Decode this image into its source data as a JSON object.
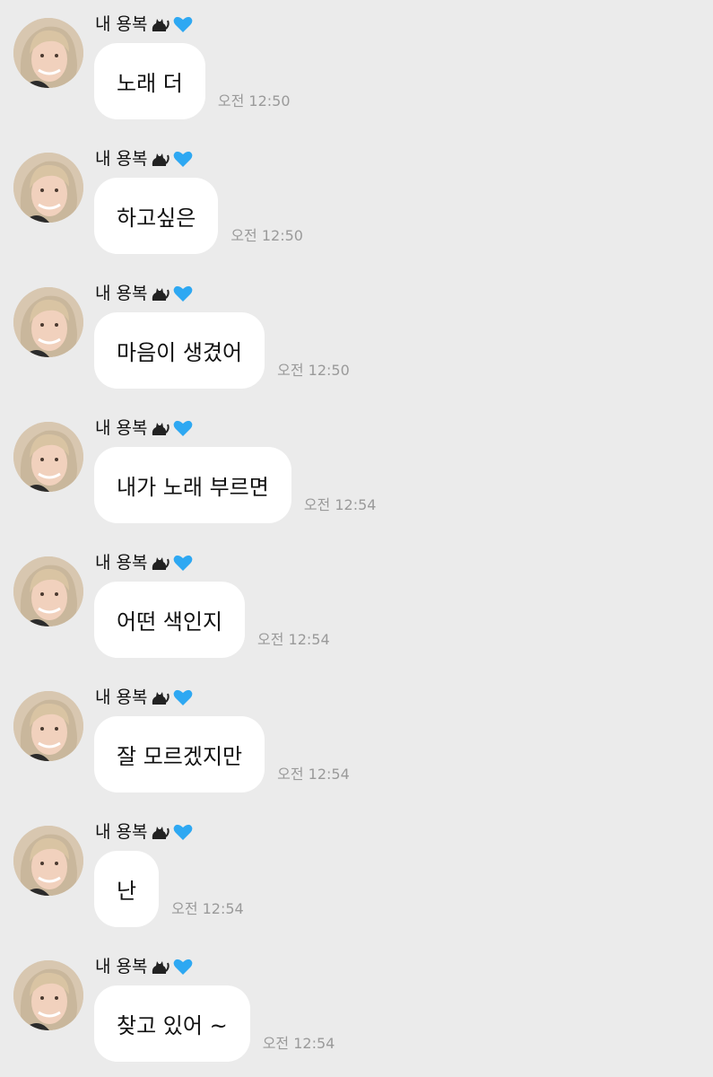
{
  "chat": {
    "messages": [
      {
        "sender": "내 용복",
        "text": "노래 더",
        "time": "오전 12:50"
      },
      {
        "sender": "내 용복",
        "text": "하고싶은",
        "time": "오전 12:50"
      },
      {
        "sender": "내 용복",
        "text": "마음이 생겼어",
        "time": "오전 12:50"
      },
      {
        "sender": "내 용복",
        "text": "내가 노래 부르면",
        "time": "오전 12:54"
      },
      {
        "sender": "내 용복",
        "text": "어떤 색인지",
        "time": "오전 12:54"
      },
      {
        "sender": "내 용복",
        "text": "잘 모르겠지만",
        "time": "오전 12:54"
      },
      {
        "sender": "내 용복",
        "text": "난",
        "time": "오전 12:54"
      },
      {
        "sender": "내 용복",
        "text": "찾고 있어 ~",
        "time": "오전 12:54"
      }
    ]
  },
  "icons": {
    "cat": "black-cat-icon",
    "heart": "blue-heart-icon"
  },
  "colors": {
    "background": "#ebebeb",
    "bubble": "#ffffff",
    "time_text": "#9a9a9a",
    "heart": "#2ea8f2"
  }
}
